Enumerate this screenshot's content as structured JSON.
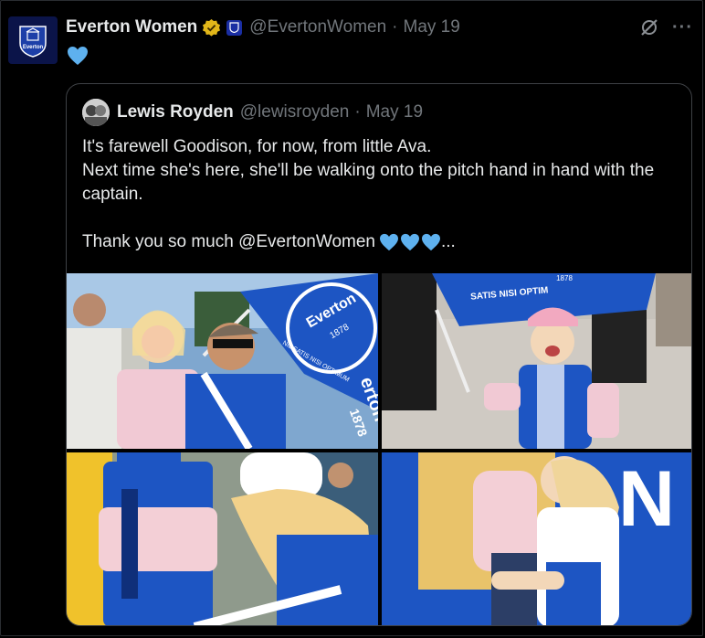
{
  "post": {
    "author_name": "Everton Women",
    "author_handle": "@EvertonWomen",
    "separator": "·",
    "date": "May 19",
    "body_emoji": "blue-heart",
    "avatar_text": "Everton"
  },
  "quoted": {
    "author_name": "Lewis Royden",
    "author_handle": "@lewisroyden",
    "separator": "·",
    "date": "May 19",
    "lines": [
      "It's farewell Goodison, for now, from little Ava.",
      "Next time she's here, she'll be walking onto the pitch hand in hand with the captain."
    ],
    "last_line": "Thank you so much @EvertonWomen",
    "last_suffix": "...",
    "hearts": [
      "blue-heart",
      "blue-heart",
      "blue-heart"
    ],
    "photo_text": {
      "flag1": "Everton",
      "flag2": "1878",
      "flag3": "NIL SATIS NISI OPTIMUM",
      "flag4": "erton",
      "flag5": "1878",
      "flag6": "SATIS NISI OPTIM",
      "flag7": "1878",
      "sign": "N"
    }
  },
  "colors": {
    "background": "#000000",
    "text": "#e7e9ea",
    "muted": "#71767b",
    "heart": "#5eb1ef",
    "verified_gold": "#e2b719",
    "everton_blue": "#1d55c3"
  }
}
